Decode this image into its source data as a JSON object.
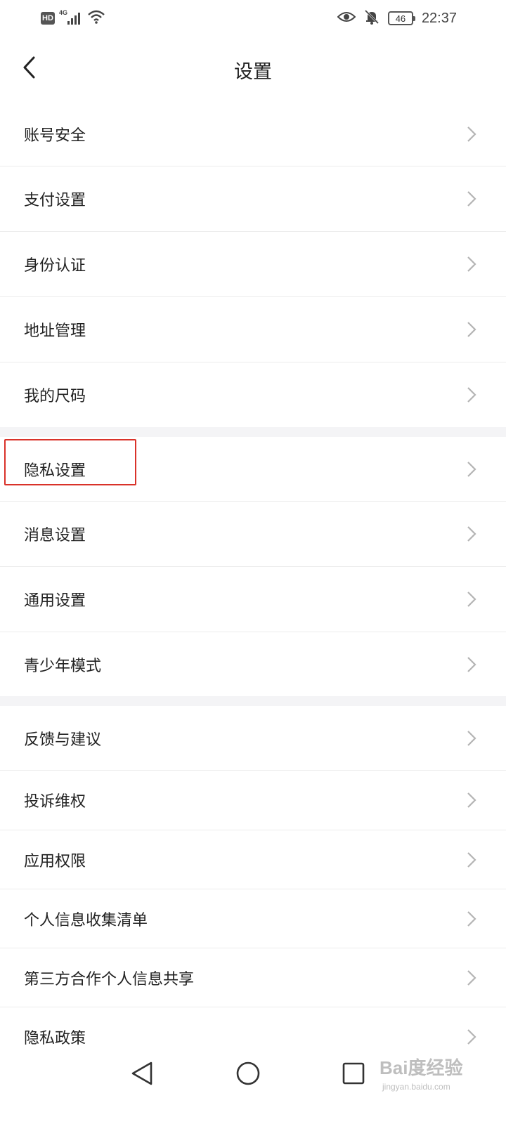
{
  "status_bar": {
    "hd_badge": "HD",
    "network_type": "4G",
    "battery_level": "46",
    "time": "22:37",
    "icons": [
      "hd-icon",
      "signal-icon",
      "wifi-icon",
      "eye-icon",
      "bell-off-icon",
      "battery-icon"
    ]
  },
  "header": {
    "back_icon": "chevron-left-icon",
    "title": "设置"
  },
  "settings": {
    "groups": [
      {
        "items": [
          {
            "label": "账号安全"
          },
          {
            "label": "支付设置"
          },
          {
            "label": "身份认证"
          },
          {
            "label": "地址管理"
          },
          {
            "label": "我的尺码"
          }
        ]
      },
      {
        "items": [
          {
            "label": "隐私设置",
            "highlighted": true
          },
          {
            "label": "消息设置"
          },
          {
            "label": "通用设置"
          },
          {
            "label": "青少年模式"
          }
        ]
      },
      {
        "items": [
          {
            "label": "反馈与建议"
          },
          {
            "label": "投诉维权"
          },
          {
            "label": "应用权限"
          },
          {
            "label": "个人信息收集清单"
          },
          {
            "label": "第三方合作个人信息共享"
          },
          {
            "label": "隐私政策"
          }
        ]
      }
    ],
    "chevron_icon": "chevron-right-icon"
  },
  "highlight_color": "#d9322a",
  "system_nav": {
    "icons": [
      "back-triangle-icon",
      "home-circle-icon",
      "recents-square-icon"
    ]
  },
  "watermark": {
    "main": "Bai度经验",
    "sub": "jingyan.baidu.com"
  }
}
